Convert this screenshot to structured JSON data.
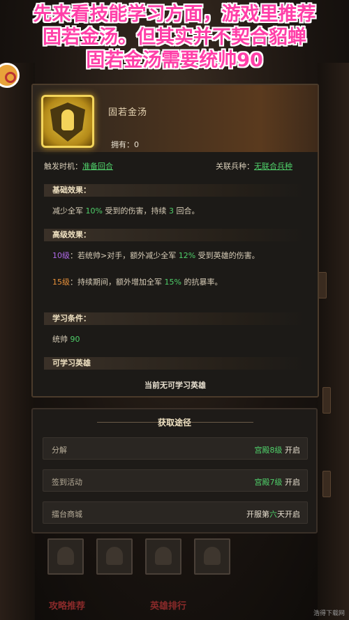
{
  "caption": {
    "line1": "先来看技能学习方面，游戏里推荐",
    "line2": "固若金汤。但其实并不契合貂蝉",
    "line3": "固若金汤需要统帅90"
  },
  "skill": {
    "name": "固若金汤",
    "owned": "拥有：0",
    "trigger_label": "触发时机：",
    "trigger_value": "准备回合",
    "link_label": "关联兵种：",
    "link_value": "无联合兵种"
  },
  "basic": {
    "title": "基础效果：",
    "t1": "减少全军 ",
    "v1": "10%",
    "t2": " 受到的伤害，持续 ",
    "v2": "3",
    "t3": " 回合。"
  },
  "advanced": {
    "title": "高级效果：",
    "l10_level": "10级",
    "l10_a": "：若统帅>对手，额外减少全军 ",
    "l10_v": "12%",
    "l10_b": " 受到英雄的伤害。",
    "l15_level": "15级",
    "l15_a": "：持续期间，额外增加全军 ",
    "l15_v": "15%",
    "l15_b": " 的抗暴率。"
  },
  "requirement": {
    "title": "学习条件：",
    "label": "统帅 ",
    "value": "90"
  },
  "heroes": {
    "title": "可学习英雄",
    "none": "当前无可学习英雄"
  },
  "acquire": {
    "title": "获取途径",
    "rows": [
      {
        "label": "分解",
        "cond": "宫殿8级",
        "suffix": " 开启"
      },
      {
        "label": "签到活动",
        "cond": "宫殿7级",
        "suffix": " 开启"
      },
      {
        "label": "擂台商城",
        "prefix": "开服第",
        "cond": "六",
        "suffix": "天开启"
      }
    ]
  },
  "bottom": {
    "tab1": "攻略推荐",
    "tab2": "英雄排行",
    "watermark": "浩得下载网"
  },
  "colors": {
    "caption": "#ff3fa8",
    "green": "#4fd06a",
    "purple": "#b06ae8",
    "orange": "#e8913a"
  }
}
